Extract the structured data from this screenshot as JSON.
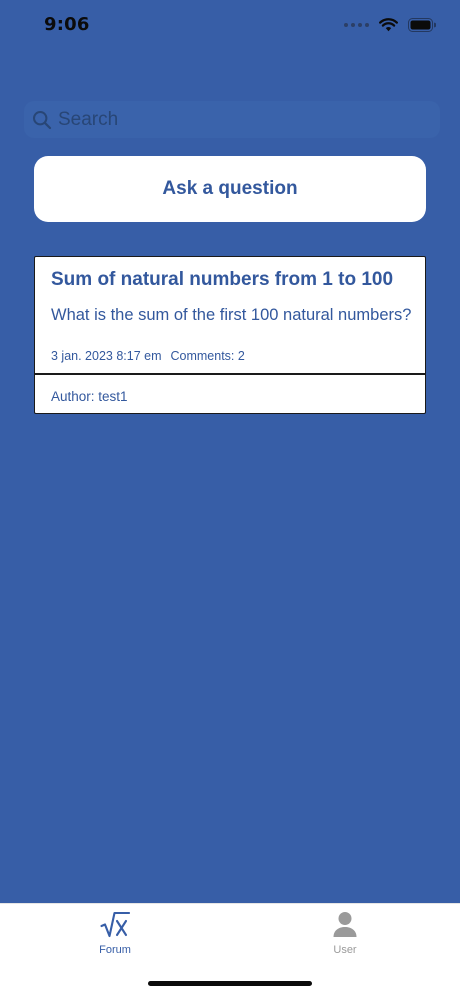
{
  "status_bar": {
    "time": "9:06"
  },
  "search": {
    "placeholder": "Search",
    "value": ""
  },
  "ask_button": {
    "label": "Ask a question"
  },
  "posts": [
    {
      "title": "Sum of natural numbers from 1 to 100",
      "body": "What is the sum of the first 100 natural numbers?",
      "date": "3 jan. 2023 8:17 em",
      "comments": "Comments: 2",
      "author": "Author: test1"
    }
  ],
  "tabs": [
    {
      "label": "Forum",
      "icon": "square-root-x-icon",
      "selected": true
    },
    {
      "label": "User",
      "icon": "person-icon",
      "selected": false
    }
  ],
  "colors": {
    "background": "#375ea7",
    "accent": "#33589d",
    "inactive_tab": "#9a9a9a"
  }
}
